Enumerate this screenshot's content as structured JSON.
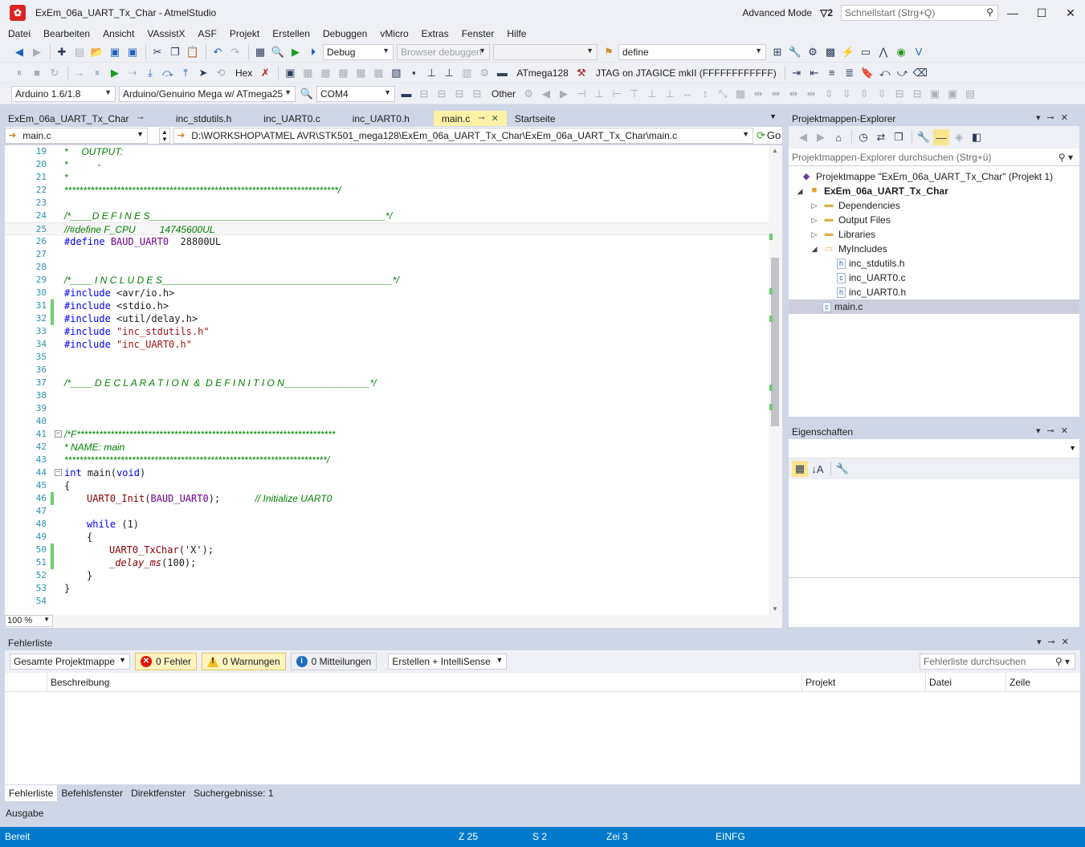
{
  "window": {
    "title": "ExEm_06a_UART_Tx_Char - AtmelStudio",
    "advanced_mode": "Advanced Mode",
    "notifications": "2",
    "quicklaunch_placeholder": "Schnellstart (Strg+Q)"
  },
  "menu": [
    "Datei",
    "Bearbeiten",
    "Ansicht",
    "VAssistX",
    "ASF",
    "Projekt",
    "Erstellen",
    "Debuggen",
    "vMicro",
    "Extras",
    "Fenster",
    "Hilfe"
  ],
  "toolbar1": {
    "config": "Debug",
    "browser_debug": "Browser debuggen",
    "find_value": "define"
  },
  "toolbar2": {
    "hex_label": "Hex",
    "device": "ATmega128",
    "debugger": "JTAG on JTAGICE mkII (FFFFFFFFFFFF)"
  },
  "toolbar3": {
    "arduino_version": "Arduino 1.6/1.8",
    "board": "Arduino/Genuino Mega w/ ATmega25",
    "port": "COM4",
    "other_label": "Other"
  },
  "doc_tabs": [
    "ExEm_06a_UART_Tx_Char",
    "inc_stdutils.h",
    "inc_UART0.c",
    "inc_UART0.h",
    "main.c",
    "Startseite"
  ],
  "nav": {
    "file": "main.c",
    "path": "D:\\WORKSHOP\\ATMEL AVR\\STK501_mega128\\ExEm_06a_UART_Tx_Char\\ExEm_06a_UART_Tx_Char\\main.c",
    "go_label": "Go"
  },
  "code": {
    "l19": "*     OUTPUT:",
    "l20": "*           -",
    "l21": "*",
    "l22": "*************************************************************************/",
    "l24": "/*____D E F I N E S____________________________________________*/",
    "l25a": "//",
    "l25b": "#define F_CPU         14745600UL",
    "l26_dir": "#define",
    "l26_name": "BAUD_UART0",
    "l26_val": "28800UL",
    "l29": "/*____ I N C L U D E S___________________________________________*/",
    "inc_dir": "#include",
    "l30": "<avr/io.h>",
    "l31": "<stdio.h>",
    "l32": "<util/delay.h>",
    "l33": "\"inc_stdutils.h\"",
    "l34": "\"inc_UART0.h\"",
    "l37": "/*____ D E C L A R A T I O N  &  D E F I N I T I O N________________*/",
    "l41": "/*F*********************************************************************",
    "l42": "* NAME: main",
    "l43": "**********************************************************************/",
    "l44_kw": "int",
    "l44_fn": "main",
    "l44_kw2": "void",
    "brace_open": "{",
    "brace_close": "}",
    "l46_fn": "UART0_Init",
    "l46_arg": "BAUD_UART0",
    "l46_cm": "// Initialize UART0",
    "l48_kw": "while",
    "l48_val": "(1)",
    "l50_fn": "UART0_TxChar",
    "l50_arg": "('X');",
    "l51_fn": "_delay_ms",
    "l51_arg": "(100);"
  },
  "editor": {
    "zoom": "100 %"
  },
  "solution_explorer": {
    "title": "Projektmappen-Explorer",
    "search_placeholder": "Projektmappen-Explorer durchsuchen (Strg+ü)",
    "items": [
      {
        "label": "Projektmappe \"ExEm_06a_UART_Tx_Char\" (Projekt 1)",
        "icon": "solution-icon"
      },
      {
        "label": "ExEm_06a_UART_Tx_Char",
        "icon": "project-icon"
      },
      {
        "label": "Dependencies",
        "icon": "folder-icon"
      },
      {
        "label": "Output Files",
        "icon": "folder-icon"
      },
      {
        "label": "Libraries",
        "icon": "folder-icon"
      },
      {
        "label": "MyIncludes",
        "icon": "folder-open-icon"
      },
      {
        "label": "inc_stdutils.h",
        "icon": "h-file-icon"
      },
      {
        "label": "inc_UART0.c",
        "icon": "c-file-icon"
      },
      {
        "label": "inc_UART0.h",
        "icon": "h-file-icon"
      },
      {
        "label": "main.c",
        "icon": "c-file-icon"
      }
    ]
  },
  "properties": {
    "title": "Eigenschaften"
  },
  "error_list": {
    "title": "Fehlerliste",
    "scope": "Gesamte Projektmappe",
    "errors": "0 Fehler",
    "warnings": "0 Warnungen",
    "messages": "0 Mitteilungen",
    "build_filter": "Erstellen + IntelliSense",
    "search_placeholder": "Fehlerliste durchsuchen",
    "columns": [
      "Beschreibung",
      "Projekt",
      "Datei",
      "Zeile"
    ]
  },
  "bottom_tabs": [
    "Fehlerliste",
    "Befehlsfenster",
    "Direktfenster",
    "Suchergebnisse: 1"
  ],
  "output_tab": "Ausgabe",
  "status": {
    "ready": "Bereit",
    "col": "Z 25",
    "char": "S 2",
    "line": "Zei 3",
    "mode": "EINFG"
  },
  "colors": {
    "accent": "#007acc",
    "active_tab": "#fff1a8",
    "comment": "#008000",
    "keyword": "#0000ff"
  }
}
